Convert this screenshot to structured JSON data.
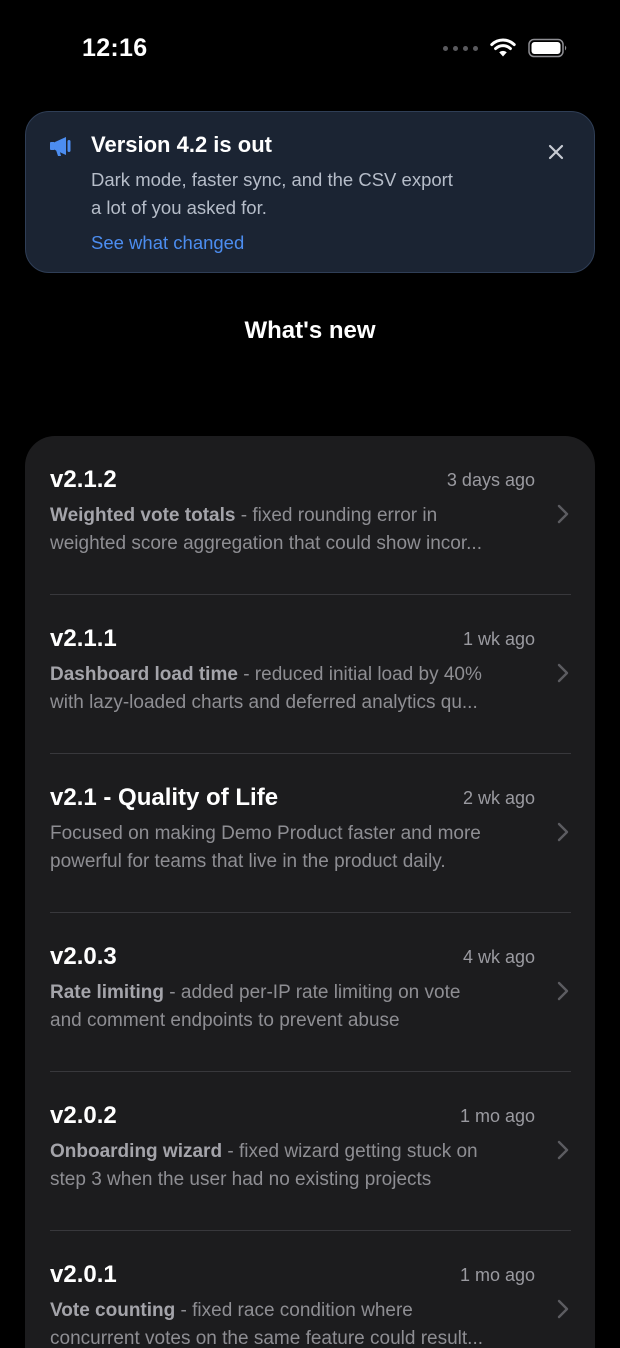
{
  "status_bar": {
    "time": "12:16"
  },
  "banner": {
    "title": "Version 4.2 is out",
    "body_line1": "Dark mode, faster sync, and the CSV export",
    "body_line2": "a lot of you asked for.",
    "link": "See what changed",
    "icon": "megaphone-icon",
    "accent": "#4c8df0"
  },
  "section": {
    "title": "What's new"
  },
  "entries": [
    {
      "version": "v2.1.2",
      "date": "3 days ago",
      "highlight": "Weighted vote totals",
      "line1_rest": " - fixed rounding error in",
      "line2": "weighted score aggregation that could show incor..."
    },
    {
      "version": "v2.1.1",
      "date": "1 wk ago",
      "highlight": "Dashboard load time",
      "line1_rest": " - reduced initial load by 40%",
      "line2": "with lazy-loaded charts and deferred analytics qu..."
    },
    {
      "version": "v2.1 - Quality of Life",
      "date": "2 wk ago",
      "highlight": "",
      "line1_rest": "Focused on making Demo Product faster and more",
      "line2": "powerful for teams that live in the product daily."
    },
    {
      "version": "v2.0.3",
      "date": "4 wk ago",
      "highlight": "Rate limiting",
      "line1_rest": " - added per-IP rate limiting on vote",
      "line2": "and comment endpoints to prevent abuse"
    },
    {
      "version": "v2.0.2",
      "date": "1 mo ago",
      "highlight": "Onboarding wizard",
      "line1_rest": " - fixed wizard getting stuck on",
      "line2": "step 3 when the user had no existing projects"
    },
    {
      "version": "v2.0.1",
      "date": "1 mo ago",
      "highlight": "Vote counting",
      "line1_rest": " - fixed race condition where",
      "line2": "concurrent votes on the same feature could result..."
    }
  ]
}
